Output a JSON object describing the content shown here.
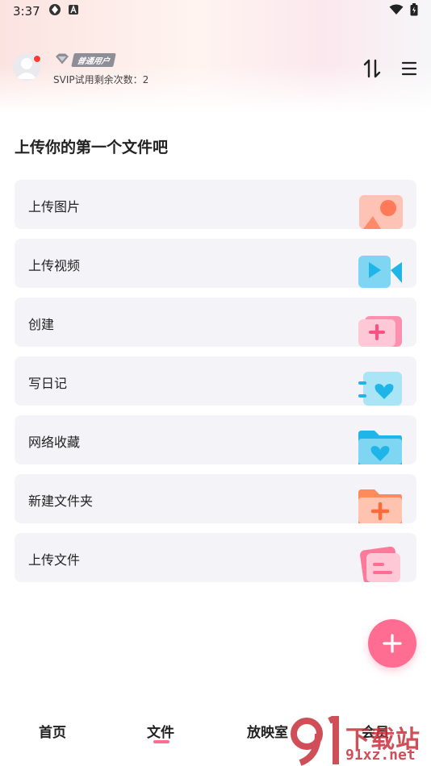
{
  "status_bar": {
    "time": "3:37"
  },
  "header": {
    "badge_label": "普通用户",
    "svip_text": "SVIP试用剩余次数：2"
  },
  "section_title": "上传你的第一个文件吧",
  "actions": [
    {
      "label": "上传图片",
      "icon": "upload-image-icon"
    },
    {
      "label": "上传视频",
      "icon": "upload-video-icon"
    },
    {
      "label": "创建",
      "icon": "create-icon"
    },
    {
      "label": "写日记",
      "icon": "diary-icon"
    },
    {
      "label": "网络收藏",
      "icon": "web-collection-icon"
    },
    {
      "label": "新建文件夹",
      "icon": "new-folder-icon"
    },
    {
      "label": "上传文件",
      "icon": "upload-file-icon"
    }
  ],
  "bottom_nav": {
    "items": [
      "首页",
      "文件",
      "放映室",
      "会员"
    ],
    "active": "文件"
  },
  "watermark": {
    "text": "下载站",
    "url": "91xz.net"
  },
  "colors": {
    "accent": "#ff6d92",
    "card_bg": "#f4f4f8"
  }
}
